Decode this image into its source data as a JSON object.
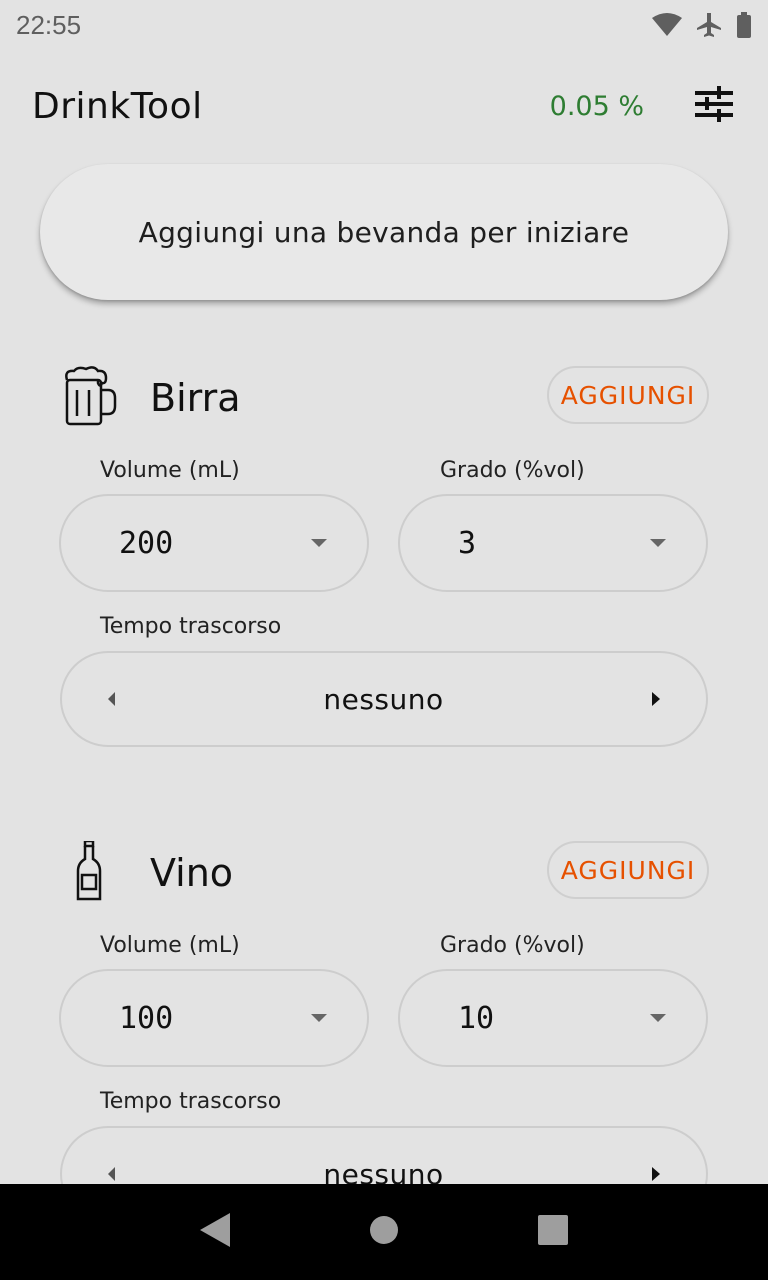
{
  "status_bar": {
    "time": "22:55",
    "icons": [
      "wifi-icon",
      "airplane-icon",
      "battery-icon"
    ]
  },
  "app_bar": {
    "title": "DrinkTool",
    "bac": "0.05 %",
    "settings_icon": "tune-icon"
  },
  "main_button": {
    "label": "Aggiungi una bevanda per iniziare"
  },
  "drinks": [
    {
      "name": "Birra",
      "icon": "beer-mug-icon",
      "add_label": "AGGIUNGI",
      "volume_label": "Volume (mL)",
      "volume_value": "200",
      "grade_label": "Grado (%vol)",
      "grade_value": "3",
      "time_label": "Tempo trascorso",
      "time_value": "nessuno"
    },
    {
      "name": "Vino",
      "icon": "wine-bottle-icon",
      "add_label": "AGGIUNGI",
      "volume_label": "Volume (mL)",
      "volume_value": "100",
      "grade_label": "Grado (%vol)",
      "grade_value": "10",
      "time_label": "Tempo trascorso",
      "time_value": "nessuno"
    }
  ],
  "nav_bar": {
    "buttons": [
      "back-icon",
      "home-icon",
      "recents-icon"
    ]
  },
  "colors": {
    "background": "#e3e3e3",
    "bac_green": "#2e7d32",
    "accent_orange": "#e65100"
  }
}
